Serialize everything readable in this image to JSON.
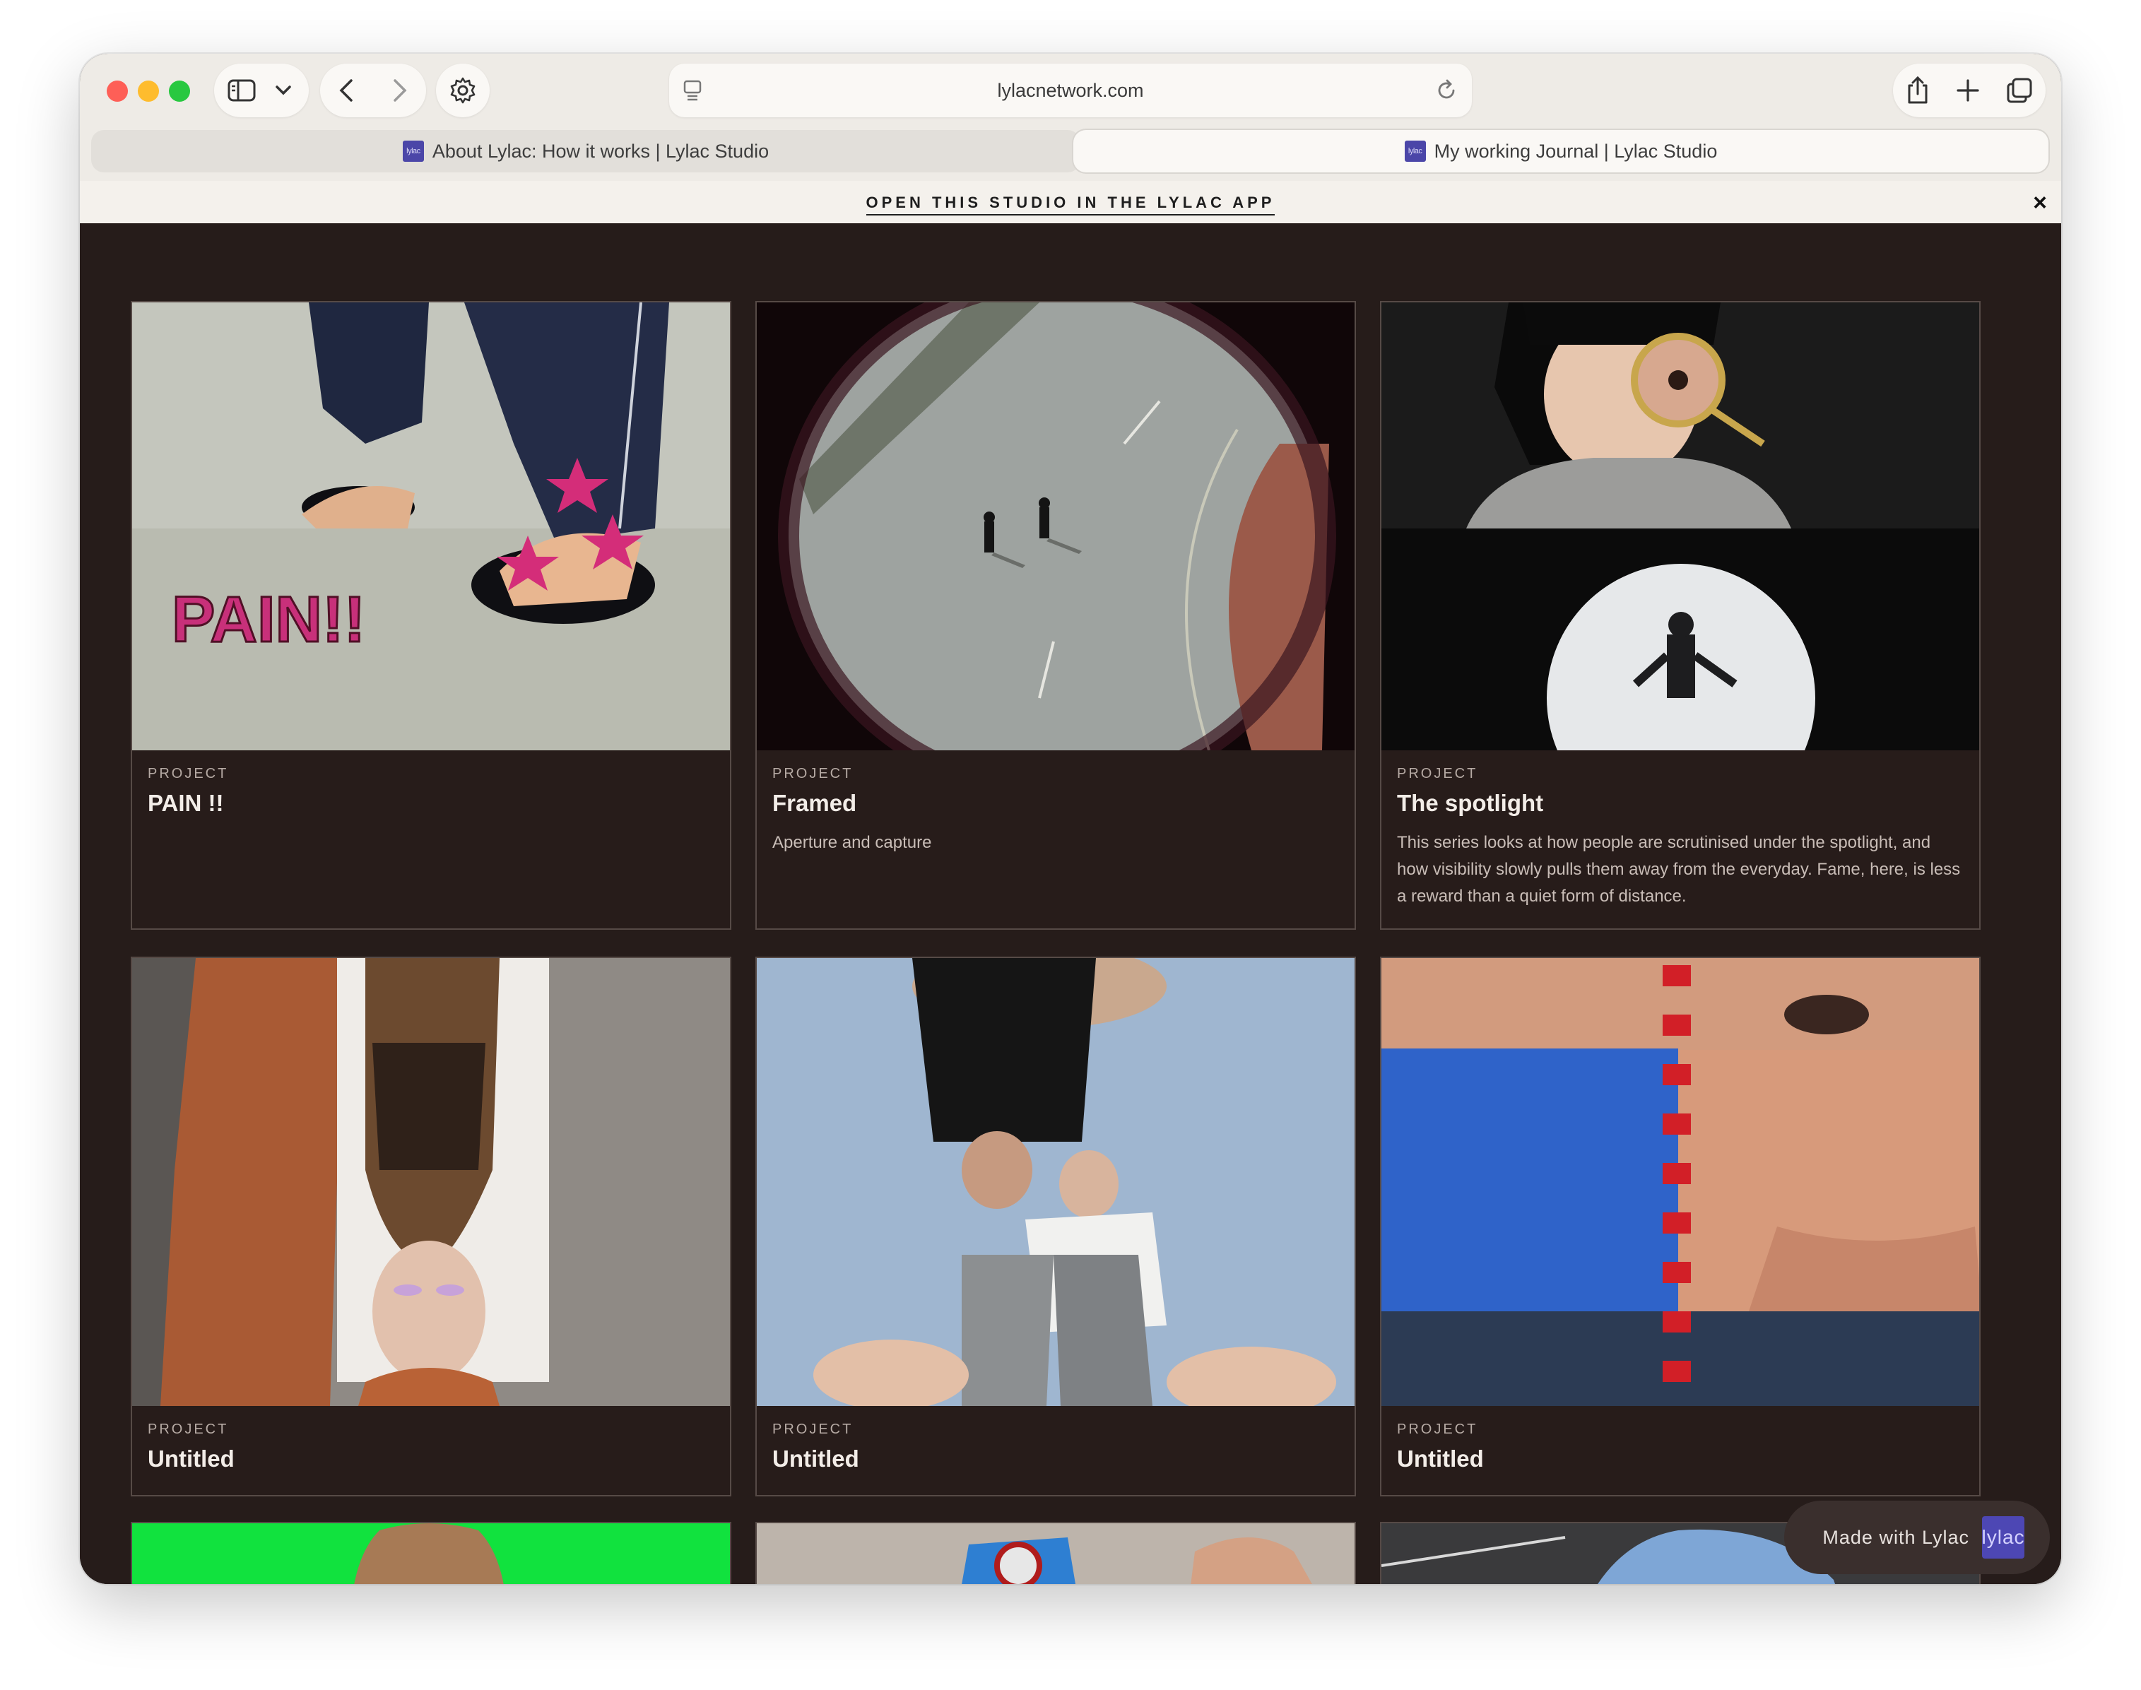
{
  "browser": {
    "url": "lylacnetwork.com",
    "tabs": [
      {
        "label": "About Lylac: How it works | Lylac Studio",
        "favicon": "lylac",
        "active": false
      },
      {
        "label": "My working Journal | Lylac Studio",
        "favicon": "lylac",
        "active": true
      }
    ]
  },
  "banner": {
    "text": "OPEN THIS STUDIO IN THE LYLAC APP",
    "close": "×"
  },
  "cards": [
    {
      "label": "PROJECT",
      "title": "PAIN !!",
      "description": "",
      "image_text": "PAIN!!"
    },
    {
      "label": "PROJECT",
      "title": "Framed",
      "description": "Aperture and capture"
    },
    {
      "label": "PROJECT",
      "title": "The spotlight",
      "description": "This series looks at how people are scrutinised under the spotlight, and how visibility slowly pulls them away from the everyday. Fame, here, is less a reward than a quiet form of distance."
    },
    {
      "label": "PROJECT",
      "title": "Untitled",
      "description": ""
    },
    {
      "label": "PROJECT",
      "title": "Untitled",
      "description": ""
    },
    {
      "label": "PROJECT",
      "title": "Untitled",
      "description": ""
    }
  ],
  "made_with": {
    "text": "Made with Lylac",
    "logo": "lylac"
  },
  "colors": {
    "page_bg": "#261c1a",
    "card_border": "#564a46",
    "lylac_brand": "#4d47b4"
  }
}
